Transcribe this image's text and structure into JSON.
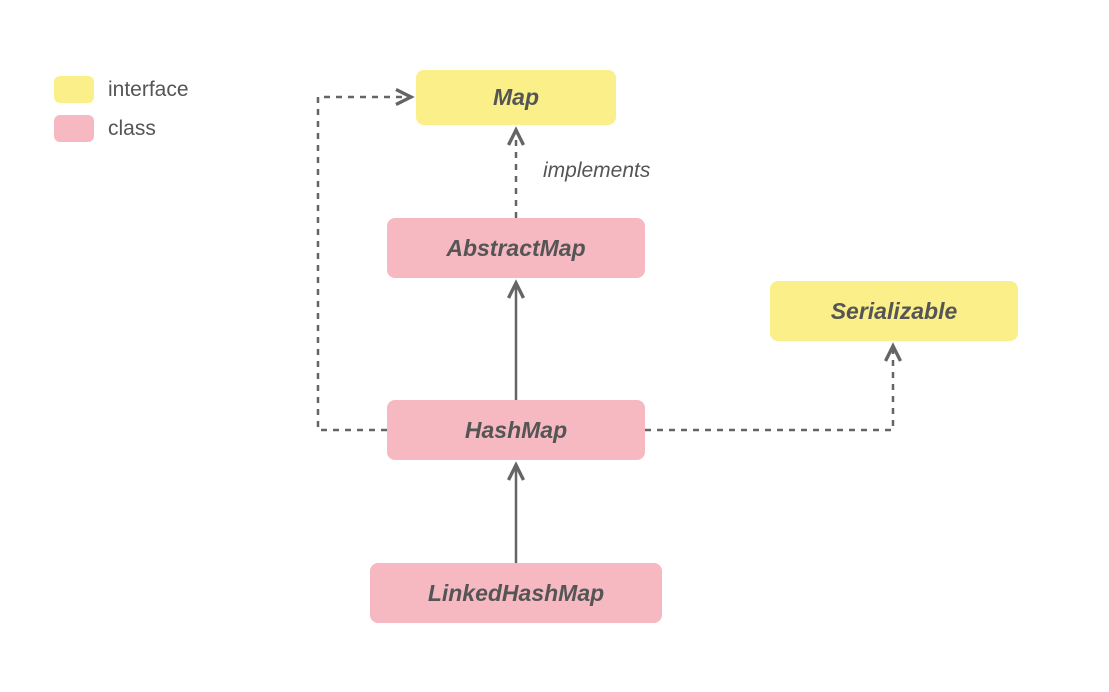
{
  "legend": {
    "interface_label": "interface",
    "class_label": "class"
  },
  "nodes": {
    "map": "Map",
    "abstractmap": "AbstractMap",
    "hashmap": "HashMap",
    "linkedhashmap": "LinkedHashMap",
    "serializable": "Serializable"
  },
  "edge_labels": {
    "implements": "implements"
  },
  "colors": {
    "interface": "#faef89",
    "class": "#f6b9c2",
    "text": "#555555",
    "connector": "#656565"
  },
  "diagram": {
    "semantics": "class-hierarchy",
    "relations": [
      {
        "from": "AbstractMap",
        "to": "Map",
        "kind": "implements",
        "style": "dashed"
      },
      {
        "from": "HashMap",
        "to": "AbstractMap",
        "kind": "extends",
        "style": "solid"
      },
      {
        "from": "LinkedHashMap",
        "to": "HashMap",
        "kind": "extends",
        "style": "solid"
      },
      {
        "from": "HashMap",
        "to": "Map",
        "kind": "implements",
        "style": "dashed"
      },
      {
        "from": "HashMap",
        "to": "Serializable",
        "kind": "implements",
        "style": "dashed"
      }
    ],
    "node_types": {
      "Map": "interface",
      "Serializable": "interface",
      "AbstractMap": "class",
      "HashMap": "class",
      "LinkedHashMap": "class"
    }
  }
}
